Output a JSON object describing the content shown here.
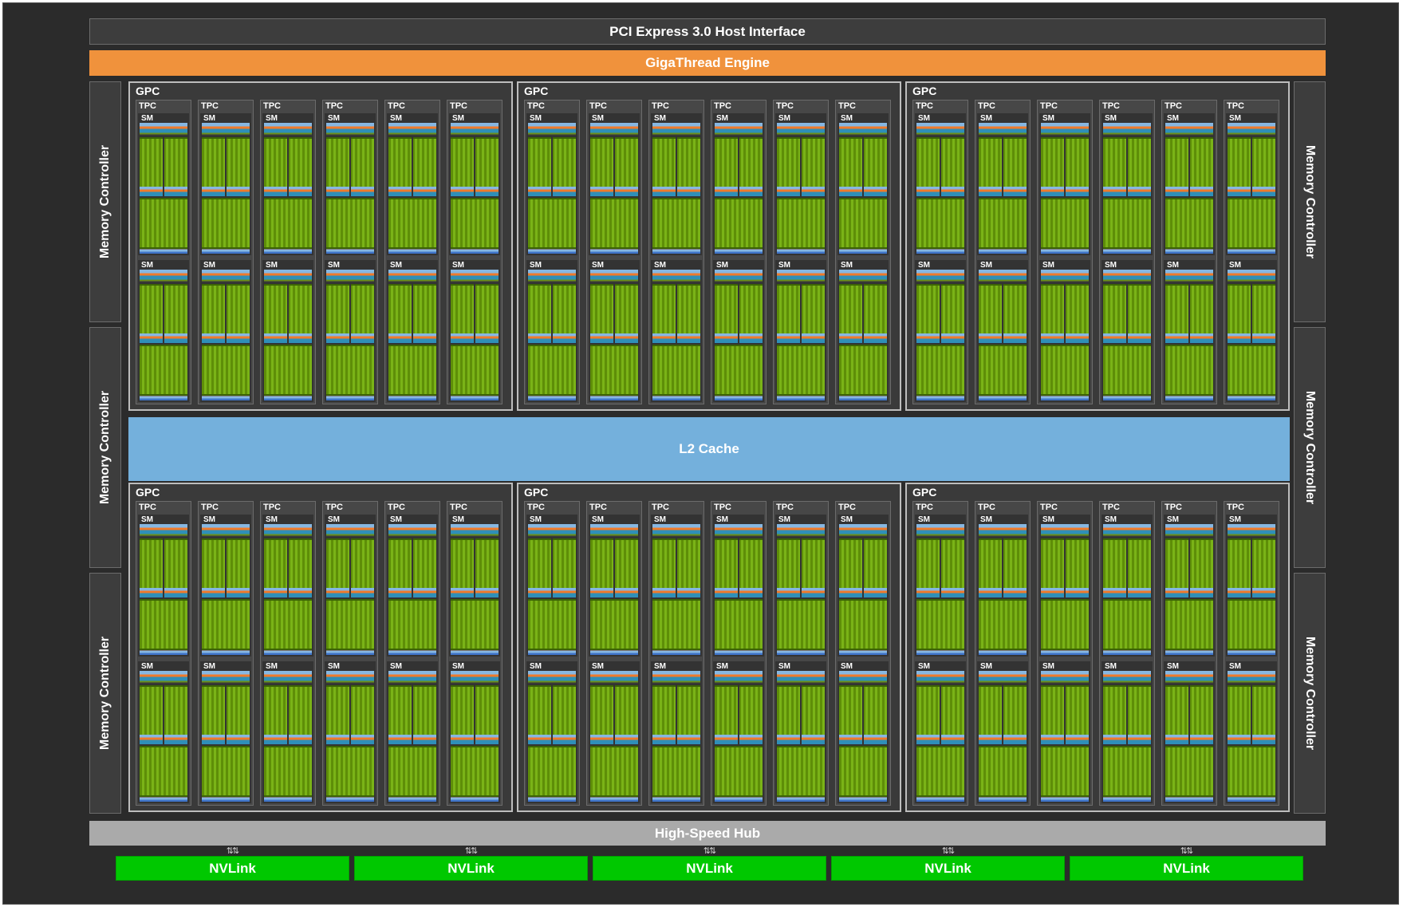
{
  "pcie": {
    "label": "PCI Express 3.0 Host Interface"
  },
  "gigathread": {
    "label": "GigaThread Engine"
  },
  "l2_cache": {
    "label": "L2 Cache"
  },
  "hub": {
    "label": "High-Speed Hub"
  },
  "memory_controller_label": "Memory Controller",
  "memory_controllers_per_side": 3,
  "gpc_label": "GPC",
  "tpc_label": "TPC",
  "sm_label": "SM",
  "gpc_rows": 2,
  "gpcs_per_row": 3,
  "tpcs_per_gpc": 6,
  "sms_per_tpc": 2,
  "nvlink": {
    "label": "NVLink",
    "count": 5,
    "arrow": "⇅⇅"
  },
  "colors": {
    "background": "#2b2b2b",
    "gigathread": "#f0923c",
    "l2_cache": "#74b0dc",
    "hub": "#aaaaaa",
    "nvlink": "#00c800",
    "cuda_core": "#7ab317"
  }
}
